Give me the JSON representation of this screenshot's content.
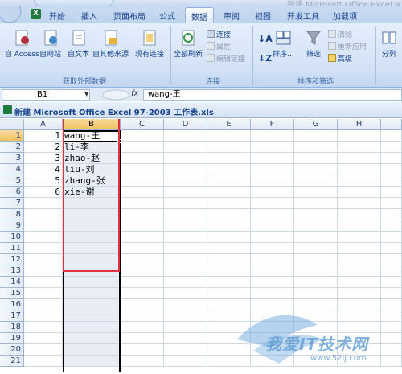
{
  "window": {
    "title": "新建 Microsoft Office Excel 97-2"
  },
  "tabs": [
    "开始",
    "插入",
    "页面布局",
    "公式",
    "数据",
    "审阅",
    "视图",
    "开发工具",
    "加载项"
  ],
  "active_tab": "数据",
  "ribbon": {
    "get_external": {
      "label": "获取外部数据",
      "buttons": [
        "自 Access",
        "自网站",
        "自文本",
        "自其他来源",
        "现有连接"
      ]
    },
    "connections": {
      "label": "连接",
      "refresh": "全部刷新",
      "items": [
        "连接",
        "属性",
        "编辑链接"
      ]
    },
    "sort_filter": {
      "label": "排序和筛选",
      "sort": "排序...",
      "filter": "筛选",
      "items": [
        "清除",
        "重新应用",
        "高级"
      ]
    },
    "outline": {
      "split": "分列"
    }
  },
  "formula_bar": {
    "name_box": "B1",
    "fx": "fx",
    "value": "wang-王"
  },
  "workbook": {
    "title": "新建 Microsoft Office Excel 97-2003 工作表.xls"
  },
  "columns": [
    "A",
    "B",
    "C",
    "D",
    "E",
    "F",
    "G",
    "H"
  ],
  "rows": [
    "1",
    "2",
    "3",
    "4",
    "5",
    "6",
    "7",
    "8",
    "9",
    "10",
    "11",
    "12",
    "13",
    "14",
    "15",
    "16",
    "17",
    "18",
    "19",
    "20",
    "21"
  ],
  "data_rows": [
    {
      "a": "1",
      "b": "wang-王"
    },
    {
      "a": "2",
      "b": "li-李"
    },
    {
      "a": "3",
      "b": "zhao-赵"
    },
    {
      "a": "4",
      "b": "liu-刘"
    },
    {
      "a": "5",
      "b": "zhang-张"
    },
    {
      "a": "6",
      "b": "xie-谢"
    }
  ],
  "selection": {
    "active_cell": "B1",
    "selected_column": "B"
  },
  "watermark": {
    "text": "我爱IT技术网",
    "url": "www.52ij.com"
  },
  "colors": {
    "accent": "#15428b",
    "selection_header": "#f1c15f",
    "highlight_box": "#e0303a"
  }
}
